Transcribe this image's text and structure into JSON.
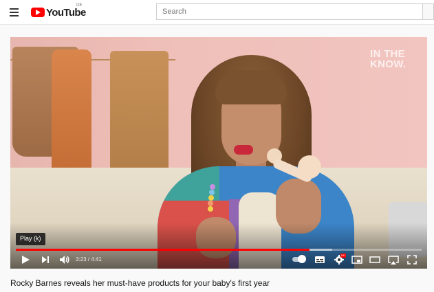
{
  "header": {
    "menu_icon": "hamburger-menu-icon",
    "logo_text": "YouTube",
    "country_code": "DE",
    "search_placeholder": "Search"
  },
  "player": {
    "watermark": "IN THE KNOW.",
    "tooltip": "Play (k)",
    "current_time": "3:23",
    "duration": "4:41",
    "time_display": "3:23 / 4:41",
    "progress_fraction": 0.724,
    "buffer_fraction": 0.78,
    "autoplay": true,
    "hd_badge": "HD",
    "controls": {
      "left": [
        "play-icon",
        "next-icon",
        "volume-icon"
      ],
      "right": [
        "autoplay-toggle",
        "subtitles-icon",
        "settings-icon",
        "miniplayer-icon",
        "theater-icon",
        "airplay-icon",
        "fullscreen-icon"
      ]
    },
    "accent_color": "#ff0000"
  },
  "video": {
    "title": "Rocky Barnes reveals her must-have products for your baby's first year"
  }
}
